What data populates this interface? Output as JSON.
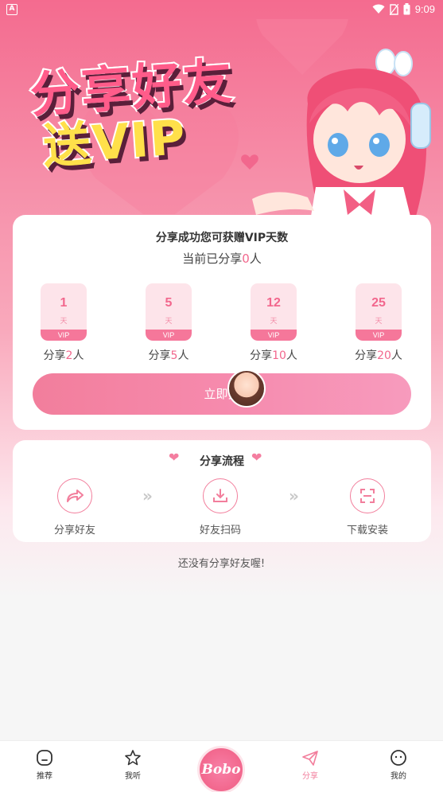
{
  "status_bar": {
    "time": "9:09",
    "left_icon": "A"
  },
  "banner": {
    "line1": "分享好友",
    "line2": "送VIP"
  },
  "card": {
    "title": "分享成功您可获赠VIP天数",
    "subtitle_prefix": "当前已分享",
    "subtitle_count": "0",
    "subtitle_suffix": "人",
    "tiers": [
      {
        "days": "1",
        "unit": "天",
        "badge": "VIP",
        "label_prefix": "分享",
        "label_count": "2",
        "label_suffix": "人"
      },
      {
        "days": "5",
        "unit": "天",
        "badge": "VIP",
        "label_prefix": "分享",
        "label_count": "5",
        "label_suffix": "人"
      },
      {
        "days": "12",
        "unit": "天",
        "badge": "VIP",
        "label_prefix": "分享",
        "label_count": "10",
        "label_suffix": "人"
      },
      {
        "days": "25",
        "unit": "天",
        "badge": "VIP",
        "label_prefix": "分享",
        "label_count": "20",
        "label_suffix": "人"
      }
    ],
    "share_button": "立即分"
  },
  "process": {
    "title": "分享流程",
    "steps": [
      {
        "label": "分享好友",
        "icon": "share-arrow-icon"
      },
      {
        "label": "好友扫码",
        "icon": "download-tray-icon"
      },
      {
        "label": "下载安装",
        "icon": "scan-frame-icon"
      }
    ]
  },
  "empty_text": "还没有分享好友喔!",
  "nav": {
    "items": [
      {
        "label": "推荐",
        "icon": "home-icon"
      },
      {
        "label": "我听",
        "icon": "star-icon"
      },
      {
        "label": "Bobo",
        "icon": "logo"
      },
      {
        "label": "分享",
        "icon": "send-icon"
      },
      {
        "label": "我的",
        "icon": "face-icon"
      }
    ]
  },
  "colors": {
    "accent": "#f27e9c",
    "hero_top": "#f46b8f",
    "vip_badge": "#f5779a"
  }
}
